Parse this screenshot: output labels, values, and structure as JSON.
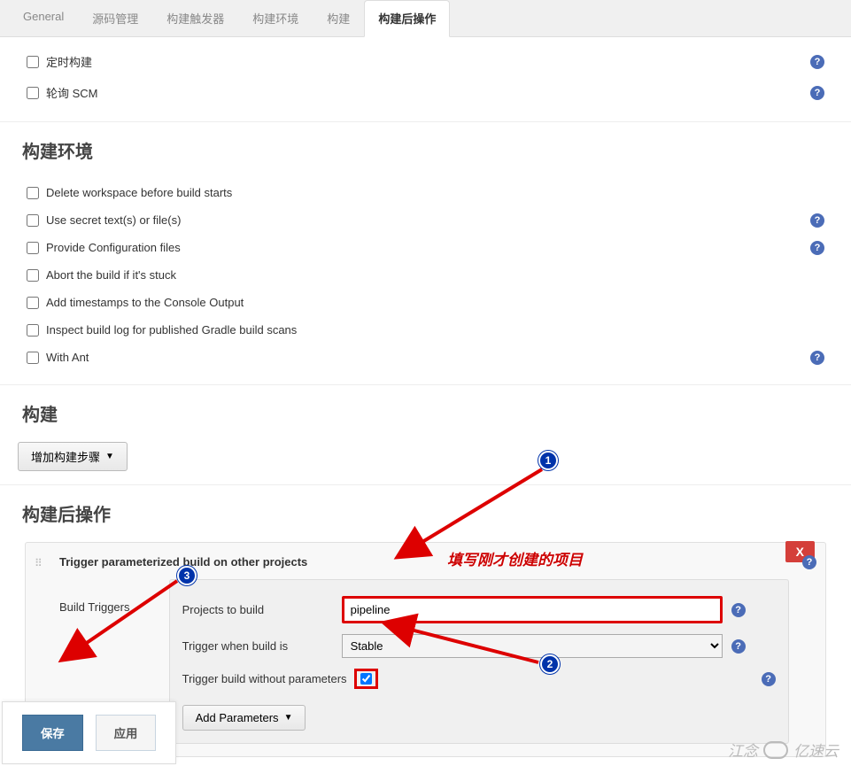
{
  "tabs": [
    {
      "label": "General"
    },
    {
      "label": "源码管理"
    },
    {
      "label": "构建触发器"
    },
    {
      "label": "构建环境"
    },
    {
      "label": "构建"
    },
    {
      "label": "构建后操作"
    }
  ],
  "trigger_checkboxes": [
    {
      "label": "定时构建",
      "help": true
    },
    {
      "label": "轮询 SCM",
      "help": true
    }
  ],
  "sections": {
    "build_env": {
      "title": "构建环境",
      "items": [
        {
          "label": "Delete workspace before build starts",
          "help": false
        },
        {
          "label": "Use secret text(s) or file(s)",
          "help": true
        },
        {
          "label": "Provide Configuration files",
          "help": true
        },
        {
          "label": "Abort the build if it's stuck",
          "help": false
        },
        {
          "label": "Add timestamps to the Console Output",
          "help": false
        },
        {
          "label": "Inspect build log for published Gradle build scans",
          "help": false
        },
        {
          "label": "With Ant",
          "help": true
        }
      ]
    },
    "build": {
      "title": "构建",
      "add_step_label": "增加构建步骤"
    },
    "post_build": {
      "title": "构建后操作",
      "block_title": "Trigger parameterized build on other projects",
      "close_label": "X",
      "triggers_label": "Build Triggers",
      "projects_label": "Projects to build",
      "projects_value": "pipeline",
      "when_label": "Trigger when build is",
      "when_value": "Stable",
      "noparam_label": "Trigger build without parameters",
      "add_params_label": "Add Parameters"
    }
  },
  "annotation": {
    "text": "填写刚才创建的项目",
    "badge1": "1",
    "badge2": "2",
    "badge3": "3"
  },
  "buttons": {
    "save": "保存",
    "apply": "应用"
  },
  "watermark": {
    "text1": "江念",
    "text2": "亿速云"
  }
}
